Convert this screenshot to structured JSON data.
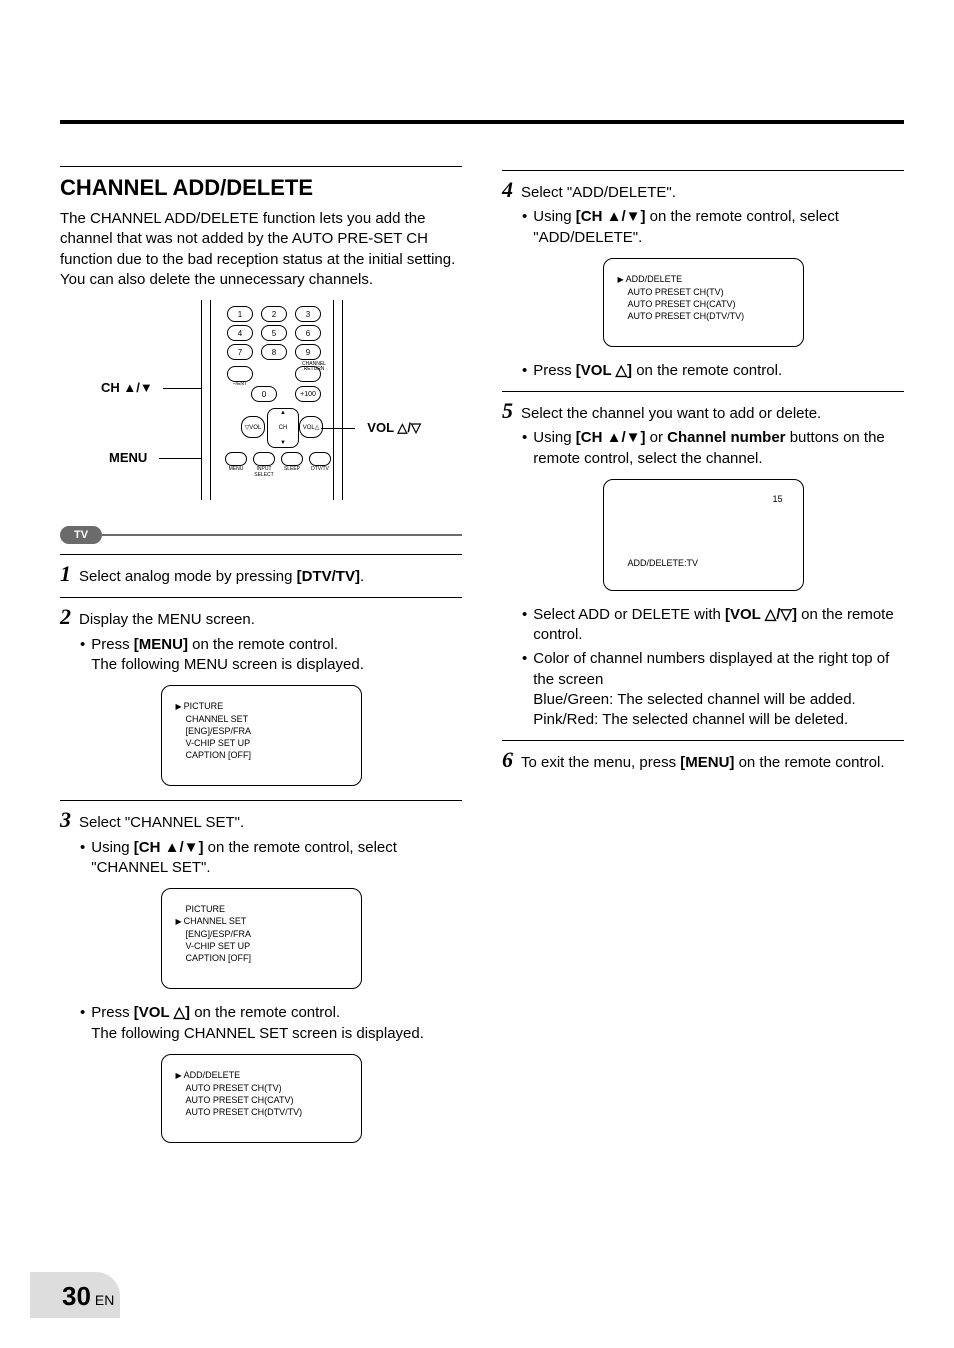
{
  "page": {
    "number": "30",
    "lang": "EN"
  },
  "header": {
    "title": "CHANNEL ADD/DELETE"
  },
  "intro": "The CHANNEL ADD/DELETE function lets you add the channel that was not added by the AUTO PRE-SET CH function due to the bad reception status at the initial setting. You can also delete the unnecessary channels.",
  "remote": {
    "callout_ch": "CH ▲/▼",
    "callout_menu": "MENU",
    "callout_vol": "VOL △/▽",
    "keys_numbers": [
      "1",
      "2",
      "3",
      "4",
      "5",
      "6",
      "7",
      "8",
      "9",
      "0"
    ],
    "row4_left_lbl": "–/ENT",
    "row4_right_lbl": "+100",
    "channel_return": "CHANNEL RETURN",
    "dpad": {
      "ch": "CH",
      "vol_left": "▽VOL",
      "vol_right": "VOL△"
    },
    "menu_row_labels": [
      "MENU",
      "INPUT SELECT",
      "SLEEP",
      "DTV/TV"
    ],
    "pill": "TV"
  },
  "steps": {
    "s1": {
      "num": "1",
      "text_a": "Select analog mode by pressing ",
      "text_b": "[DTV/TV]",
      "text_c": "."
    },
    "s2": {
      "num": "2",
      "title": "Display the MENU screen.",
      "b1_a": "Press ",
      "b1_b": "[MENU]",
      "b1_c": " on the remote control.",
      "b1_line2": "The following MENU screen is displayed."
    },
    "s3": {
      "num": "3",
      "title": "Select \"CHANNEL SET\".",
      "b1_a": "Using ",
      "b1_b": "[CH ▲/▼]",
      "b1_c": " on the remote control, select \"CHANNEL SET\".",
      "b2_a": "Press ",
      "b2_b": "[VOL △]",
      "b2_c": " on the remote control.",
      "b2_line2": "The following CHANNEL SET screen is displayed."
    },
    "s4": {
      "num": "4",
      "title": "Select \"ADD/DELETE\".",
      "b1_a": "Using ",
      "b1_b": "[CH ▲/▼]",
      "b1_c": " on the remote control, select \"ADD/DELETE\".",
      "b2_a": "Press ",
      "b2_b": "[VOL △]",
      "b2_c": " on the remote control."
    },
    "s5": {
      "num": "5",
      "title": "Select the channel you want to add or delete.",
      "b1_a": "Using ",
      "b1_b": "[CH ▲/▼]",
      "b1_c": " or ",
      "b1_d": "Channel number",
      "b1_e": " buttons on the remote control, select the channel.",
      "b2_a": "Select ADD or DELETE with ",
      "b2_b": "[VOL △/▽]",
      "b2_c": " on the remote control.",
      "b3_line1": "Color of channel numbers displayed at the right top of the screen",
      "b3_line2": "Blue/Green: The selected channel will be added.",
      "b3_line3": "Pink/Red: The selected channel will be deleted."
    },
    "s6": {
      "num": "6",
      "text_a": "To exit the menu, press ",
      "text_b": "[MENU]",
      "text_c": " on the remote control."
    }
  },
  "osd": {
    "menu1": [
      "PICTURE",
      "CHANNEL SET",
      "[ENG]/ESP/FRA",
      "V-CHIP SET UP",
      "CAPTION [OFF]"
    ],
    "menu1_selected_index": 0,
    "menu2": [
      "PICTURE",
      "CHANNEL SET",
      "[ENG]/ESP/FRA",
      "V-CHIP SET UP",
      "CAPTION [OFF]"
    ],
    "menu2_selected_index": 1,
    "chset1": [
      "ADD/DELETE",
      "AUTO PRESET CH(TV)",
      "AUTO PRESET CH(CATV)",
      "AUTO PRESET CH(DTV/TV)"
    ],
    "chset1_selected_index": 0,
    "chset2": [
      "ADD/DELETE",
      "AUTO PRESET CH(TV)",
      "AUTO PRESET CH(CATV)",
      "AUTO PRESET CH(DTV/TV)"
    ],
    "chset2_selected_index": 0,
    "adddel": {
      "channel": "15",
      "label": "ADD/DELETE:TV"
    }
  }
}
